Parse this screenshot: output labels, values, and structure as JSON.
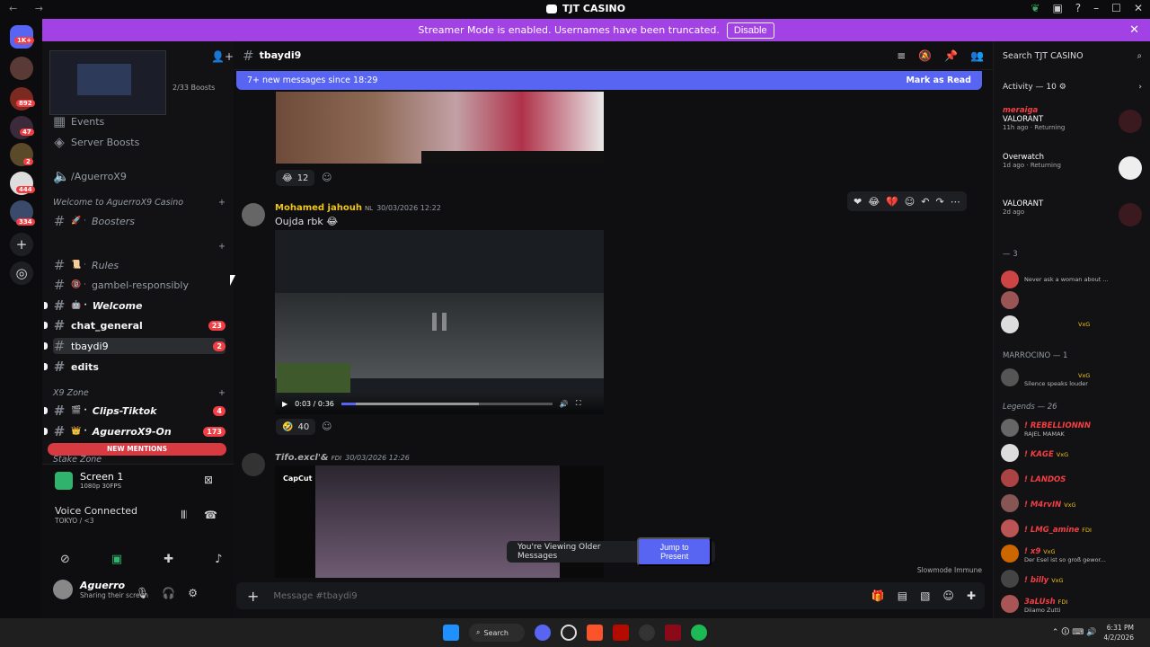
{
  "window": {
    "title": "TJT CASINO",
    "nav": "← →"
  },
  "banner": {
    "text": "Streamer Mode is enabled. Usernames have been truncated.",
    "disable": "Disable",
    "close": "✕"
  },
  "rail": {
    "home_badge": "1K+",
    "badges": [
      "892",
      "47",
      "2",
      "444",
      "334"
    ]
  },
  "sidebar": {
    "boosts": "2/33 Boosts",
    "items": [
      {
        "label": "Events",
        "icon": "calendar-icon"
      },
      {
        "label": "Server Boosts",
        "icon": "boost-icon"
      },
      {
        "label": "/AguerroX9",
        "icon": "speaker-icon"
      }
    ],
    "category1": "Welcome to AguerroX9 Casino",
    "category2": "",
    "category3": "X9 Zone",
    "category4": "Stake Zone",
    "channels": {
      "boosters": "Boosters",
      "rules": "Rules",
      "gamble": "gambel-responsibly",
      "welcome": "Welcome",
      "chat_general": "chat_general",
      "chat_general_count": "23",
      "tbaydi9": "tbaydi9",
      "tbaydi9_count": "2",
      "edits": "edits",
      "clips": "Clips-Tiktok",
      "clips_count": "4",
      "aguerro_on": "AguerroX9-On",
      "aguerro_on_count": "173"
    },
    "new_mentions": "NEW MENTIONS",
    "screen": {
      "name": "Screen 1",
      "fps": "1080p 30FPS"
    },
    "voice": {
      "status": "Voice Connected",
      "location": "TOKYO / <3"
    },
    "user": {
      "name": "Aguerro",
      "status": "Sharing their screen"
    }
  },
  "chat": {
    "channel": "tbaydi9",
    "new_messages": "7+ new messages since 18:29",
    "mark_read": "Mark as Read",
    "reaction1": {
      "emoji": "😂",
      "count": "12"
    },
    "message2": {
      "author": "Mohamed jahouh",
      "tag": "NL",
      "time": "30/03/2026 12:22",
      "text": "Oujda rbk 😂",
      "video_time": "0:03 / 0:36",
      "video_progress": 0.07,
      "video_buffered": 0.65
    },
    "reaction2": {
      "emoji": "🤣",
      "count": "40"
    },
    "message3": {
      "author": "Tifo.excl'&",
      "tag": "FDI",
      "time": "30/03/2026 12:26",
      "watermark": "CapCut"
    },
    "older": "You're Viewing Older Messages",
    "jump": "Jump to Present",
    "slowmode": "Slowmode Immune",
    "placeholder": "Message #tbaydi9",
    "colors": {
      "accent": "#5865f2",
      "banner": "#a241e4",
      "mention": "#f23f43"
    }
  },
  "members": {
    "search_placeholder": "Search TJT CASINO",
    "activity_header": "Activity — 10",
    "activities": [
      {
        "name": "meraiga",
        "game": "VALORANT",
        "time": "11h ago",
        "state": "Returning"
      },
      {
        "name": "",
        "game": "Overwatch",
        "time": "1d ago",
        "state": "Returning"
      },
      {
        "name": "",
        "game": "VALORANT",
        "time": "2d ago",
        "state": ""
      }
    ],
    "group1": "— 3",
    "group1_members": [
      {
        "name": "",
        "sub": "Never ask a woman about ...",
        "tag": ""
      },
      {
        "name": "",
        "sub": "",
        "tag": ""
      },
      {
        "name": "",
        "sub": "",
        "tag": "VxG"
      }
    ],
    "group2": "MARROCINO — 1",
    "group2_members": [
      {
        "name": "",
        "sub": "Silence speaks louder",
        "tag": "VxG"
      }
    ],
    "group3": "Legends — 26",
    "group3_members": [
      {
        "name": "! REBELLIONNN",
        "sub": "RAJEL MAMAK",
        "tag": ""
      },
      {
        "name": "! KAGE",
        "sub": "",
        "tag": "VxG"
      },
      {
        "name": "! LANDOS",
        "sub": "",
        "tag": ""
      },
      {
        "name": "! M4rvIN",
        "sub": "",
        "tag": "VxG"
      },
      {
        "name": "! LMG_amine",
        "sub": "",
        "tag": "FDI"
      },
      {
        "name": "! x9",
        "sub": "Der Esel ist so groß gewor...",
        "tag": "VxG"
      },
      {
        "name": "! billy",
        "sub": "",
        "tag": "VxG"
      },
      {
        "name": "3aLUsh",
        "sub": "Diiamo Zutti",
        "tag": "FDI"
      }
    ]
  },
  "taskbar": {
    "search": "Search",
    "time": "6:31 PM",
    "date": "4/2/2026"
  }
}
